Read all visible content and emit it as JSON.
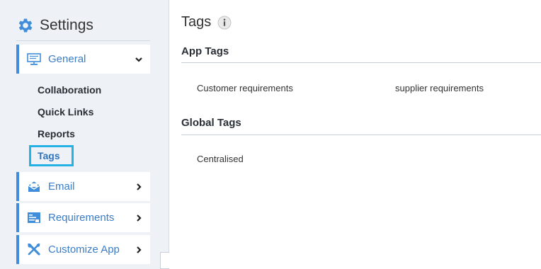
{
  "sidebar": {
    "title": "Settings",
    "sections": [
      {
        "label": "General",
        "icon": "monitor-icon",
        "expanded": true
      },
      {
        "label": "Email",
        "icon": "envelope-icon",
        "expanded": false
      },
      {
        "label": "Requirements",
        "icon": "list-document-icon",
        "expanded": false
      },
      {
        "label": "Customize App",
        "icon": "tools-icon",
        "expanded": false
      }
    ],
    "general_items": [
      {
        "label": "Collaboration"
      },
      {
        "label": "Quick Links"
      },
      {
        "label": "Reports"
      },
      {
        "label": "Tags",
        "active": true
      }
    ]
  },
  "main": {
    "title": "Tags",
    "groups": [
      {
        "title": "App Tags",
        "tags": [
          "Customer requirements",
          "supplier requirements"
        ]
      },
      {
        "title": "Global Tags",
        "tags": [
          "Centralised"
        ]
      }
    ]
  },
  "colors": {
    "accent": "#3f8ddb",
    "active_highlight": "#24b2e6",
    "sidebar_bg": "#eef1f6"
  }
}
